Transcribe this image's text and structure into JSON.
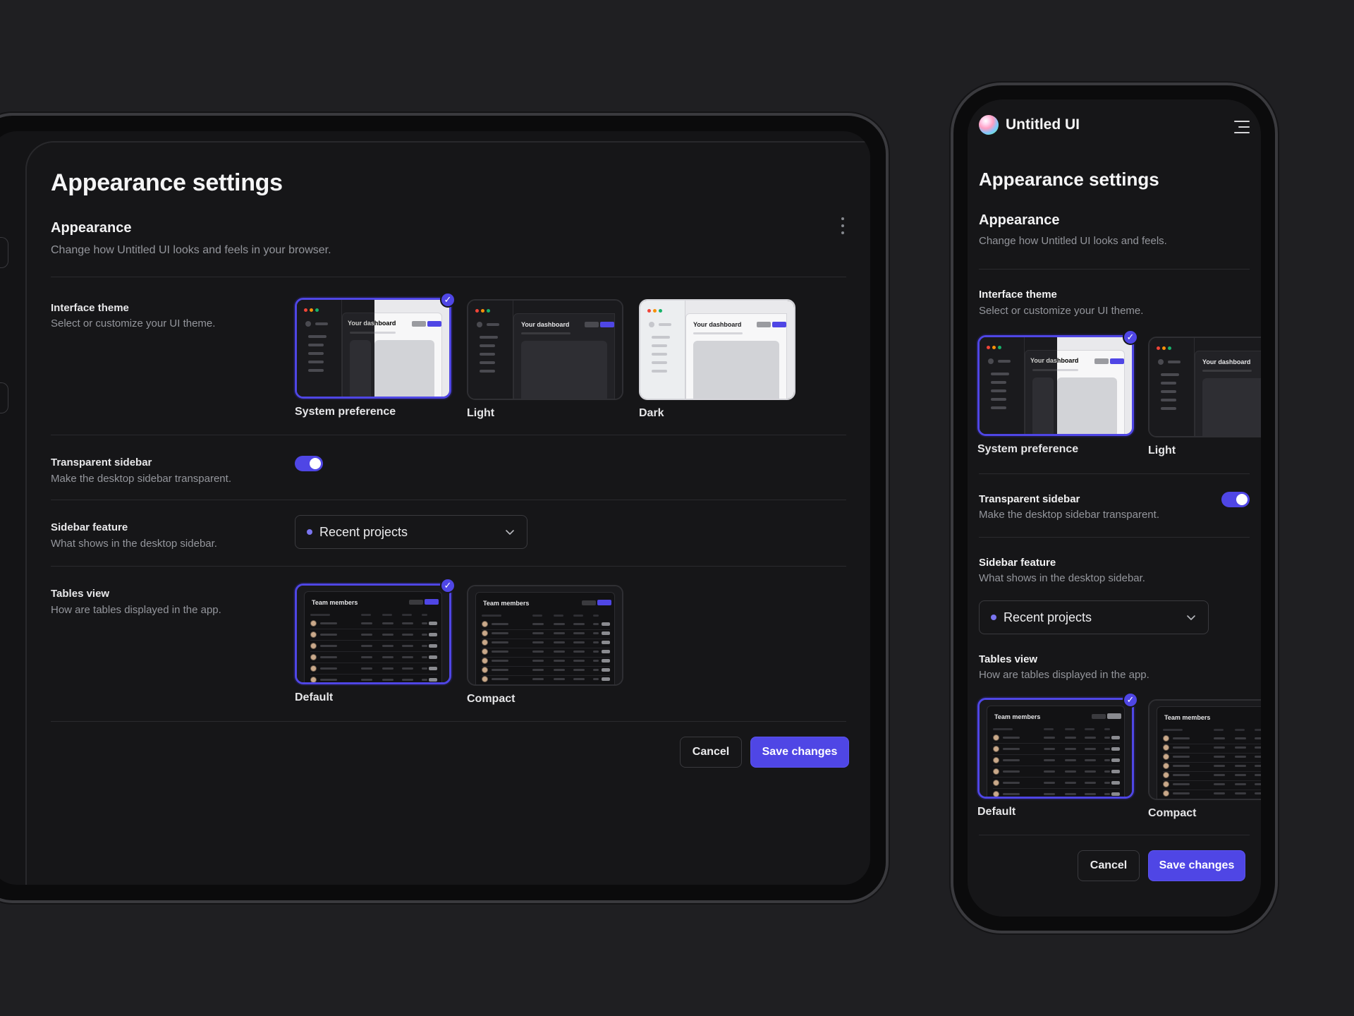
{
  "tablet": {
    "page_title": "Appearance settings",
    "section": {
      "title": "Appearance",
      "description": "Change how Untitled UI looks and feels in your browser."
    },
    "interface_theme": {
      "label": "Interface theme",
      "description": "Select or customize your UI theme.",
      "options": [
        {
          "label": "System preference",
          "selected": true
        },
        {
          "label": "Light",
          "selected": false
        },
        {
          "label": "Dark",
          "selected": false
        }
      ],
      "thumb_text": "Your dashboard"
    },
    "transparent_sidebar": {
      "label": "Transparent sidebar",
      "description": "Make the desktop sidebar transparent.",
      "enabled": true
    },
    "sidebar_feature": {
      "label": "Sidebar feature",
      "description": "What shows in the desktop sidebar.",
      "value": "Recent projects"
    },
    "tables_view": {
      "label": "Tables view",
      "description": "How are tables displayed in the app.",
      "options": [
        {
          "label": "Default",
          "selected": true
        },
        {
          "label": "Compact",
          "selected": false
        }
      ],
      "thumb_text": "Team members"
    },
    "actions": {
      "cancel": "Cancel",
      "save": "Save changes"
    }
  },
  "phone": {
    "brand": "Untitled UI",
    "page_title": "Appearance settings",
    "section": {
      "title": "Appearance",
      "description": "Change how Untitled UI looks and feels."
    },
    "interface_theme": {
      "label": "Interface theme",
      "description": "Select or customize your UI theme.",
      "options": [
        {
          "label": "System preference",
          "selected": true
        },
        {
          "label": "Light",
          "selected": false
        }
      ],
      "thumb_text": "Your dashboard"
    },
    "transparent_sidebar": {
      "label": "Transparent sidebar",
      "description": "Make the desktop sidebar transparent.",
      "enabled": true
    },
    "sidebar_feature": {
      "label": "Sidebar feature",
      "description": "What shows in the desktop sidebar.",
      "value": "Recent projects"
    },
    "tables_view": {
      "label": "Tables view",
      "description": "How are tables displayed in the app.",
      "options": [
        {
          "label": "Default",
          "selected": true
        },
        {
          "label": "Compact",
          "selected": false
        }
      ],
      "thumb_text": "Team members"
    },
    "actions": {
      "cancel": "Cancel",
      "save": "Save changes"
    }
  },
  "colors": {
    "background": "#1f1f22",
    "panel": "#161618",
    "accent": "#4f46e5",
    "muted_text": "#94969c"
  },
  "icons": {
    "check": "check-icon",
    "chevron": "chevron-down-icon",
    "menu": "menu-icon",
    "more": "more-vertical-icon"
  }
}
